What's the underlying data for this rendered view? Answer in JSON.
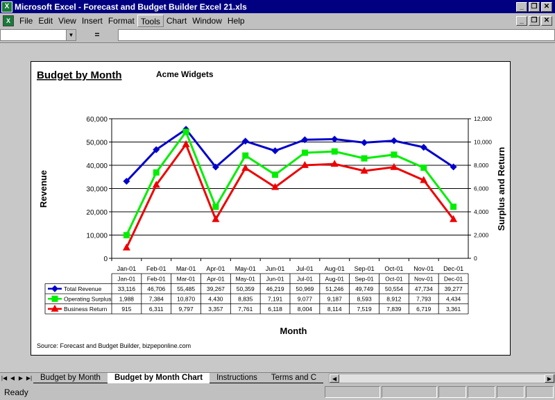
{
  "window": {
    "title": "Microsoft Excel - Forecast and Budget Builder Excel 21.xls",
    "app_icon_letter": "X"
  },
  "menu": [
    "File",
    "Edit",
    "View",
    "Insert",
    "Format",
    "Tools",
    "Chart",
    "Window",
    "Help"
  ],
  "menu_active": "Tools",
  "formula_bar": {
    "name_box": "",
    "equals": "=",
    "content": ""
  },
  "chart_data": {
    "type": "line",
    "title": "Budget by Month",
    "subtitle": "Acme Widgets",
    "xlabel": "Month",
    "ylabel_left": "Revenue",
    "ylabel_right": "Surplus and Return",
    "categories": [
      "Jan-01",
      "Feb-01",
      "Mar-01",
      "Apr-01",
      "May-01",
      "Jun-01",
      "Jul-01",
      "Aug-01",
      "Sep-01",
      "Oct-01",
      "Nov-01",
      "Dec-01"
    ],
    "ylim_left": [
      0,
      60000
    ],
    "ylim_right": [
      0,
      12000
    ],
    "yticks_left": [
      "0",
      "10,000",
      "20,000",
      "30,000",
      "40,000",
      "50,000",
      "60,000"
    ],
    "yticks_right": [
      "0",
      "2,000",
      "4,000",
      "6,000",
      "8,000",
      "10,000",
      "12,000"
    ],
    "grid": true,
    "series": [
      {
        "name": "Total Revenue",
        "axis": "left",
        "color": "#0000cc",
        "marker": "diamond",
        "values": [
          33116,
          46706,
          55485,
          39267,
          50359,
          46219,
          50969,
          51246,
          49749,
          50554,
          47734,
          39277
        ],
        "labels": [
          "33,116",
          "46,706",
          "55,485",
          "39,267",
          "50,359",
          "46,219",
          "50,969",
          "51,246",
          "49,749",
          "50,554",
          "47,734",
          "39,277"
        ]
      },
      {
        "name": "Operating Surplus",
        "axis": "right",
        "color": "#00ee00",
        "marker": "square",
        "values": [
          1988,
          7384,
          10870,
          4430,
          8835,
          7191,
          9077,
          9187,
          8593,
          8912,
          7793,
          4434
        ],
        "labels": [
          "1,988",
          "7,384",
          "10,870",
          "4,430",
          "8,835",
          "7,191",
          "9,077",
          "9,187",
          "8,593",
          "8,912",
          "7,793",
          "4,434"
        ]
      },
      {
        "name": "Business Return",
        "axis": "right",
        "color": "#ee0000",
        "marker": "triangle",
        "values": [
          915,
          6311,
          9797,
          3357,
          7761,
          6118,
          8004,
          8114,
          7519,
          7839,
          6719,
          3361
        ],
        "labels": [
          "915",
          "6,311",
          "9,797",
          "3,357",
          "7,761",
          "6,118",
          "8,004",
          "8,114",
          "7,519",
          "7,839",
          "6,719",
          "3,361"
        ]
      }
    ],
    "source": "Source: Forecast and Budget Builder, bizpeponline.com"
  },
  "sheet_tabs": [
    "Budget by Month",
    "Budget by Month Chart",
    "Instructions",
    "Terms and C"
  ],
  "active_tab": "Budget by Month Chart",
  "status": "Ready"
}
